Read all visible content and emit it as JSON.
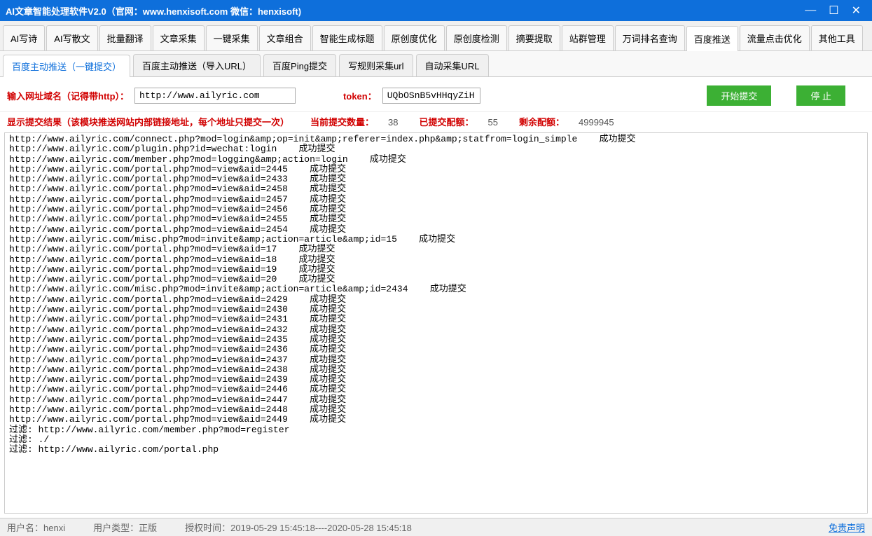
{
  "title": "AI文章智能处理软件V2.0（官网：www.henxisoft.com  微信：henxisoft)",
  "maintabs": [
    "AI写诗",
    "AI写散文",
    "批量翻译",
    "文章采集",
    "一键采集",
    "文章组合",
    "智能生成标题",
    "原创度优化",
    "原创度检测",
    "摘要提取",
    "站群管理",
    "万词排名查询",
    "百度推送",
    "流量点击优化",
    "其他工具"
  ],
  "maintab_active": 12,
  "subtabs": [
    "百度主动推送（一键提交）",
    "百度主动推送（导入URL）",
    "百度Ping提交",
    "写规则采集url",
    "自动采集URL"
  ],
  "subtab_active": 0,
  "form": {
    "url_label": "输入网址域名（记得带http）：",
    "url_value": "http://www.ailyric.com",
    "token_label": "token：",
    "token_value": "UQbOSnB5vHHqyZiH",
    "start_btn": "开始提交",
    "stop_btn": "停  止"
  },
  "result": {
    "header_label": "显示提交结果（该模块推送网站内部链接地址，每个地址只提交一次）",
    "current_label": "当前提交数量：",
    "current_val": "38",
    "submitted_label": "已提交配额：",
    "submitted_val": "55",
    "remain_label": "剩余配额：",
    "remain_val": "4999945"
  },
  "log": [
    "http://www.ailyric.com/connect.php?mod=login&amp;op=init&amp;referer=index.php&amp;statfrom=login_simple    成功提交",
    "http://www.ailyric.com/plugin.php?id=wechat:login    成功提交",
    "http://www.ailyric.com/member.php?mod=logging&amp;action=login    成功提交",
    "http://www.ailyric.com/portal.php?mod=view&aid=2445    成功提交",
    "http://www.ailyric.com/portal.php?mod=view&aid=2433    成功提交",
    "http://www.ailyric.com/portal.php?mod=view&aid=2458    成功提交",
    "http://www.ailyric.com/portal.php?mod=view&aid=2457    成功提交",
    "http://www.ailyric.com/portal.php?mod=view&aid=2456    成功提交",
    "http://www.ailyric.com/portal.php?mod=view&aid=2455    成功提交",
    "http://www.ailyric.com/portal.php?mod=view&aid=2454    成功提交",
    "http://www.ailyric.com/misc.php?mod=invite&amp;action=article&amp;id=15    成功提交",
    "http://www.ailyric.com/portal.php?mod=view&aid=17    成功提交",
    "http://www.ailyric.com/portal.php?mod=view&aid=18    成功提交",
    "http://www.ailyric.com/portal.php?mod=view&aid=19    成功提交",
    "http://www.ailyric.com/portal.php?mod=view&aid=20    成功提交",
    "http://www.ailyric.com/misc.php?mod=invite&amp;action=article&amp;id=2434    成功提交",
    "http://www.ailyric.com/portal.php?mod=view&aid=2429    成功提交",
    "http://www.ailyric.com/portal.php?mod=view&aid=2430    成功提交",
    "http://www.ailyric.com/portal.php?mod=view&aid=2431    成功提交",
    "http://www.ailyric.com/portal.php?mod=view&aid=2432    成功提交",
    "http://www.ailyric.com/portal.php?mod=view&aid=2435    成功提交",
    "http://www.ailyric.com/portal.php?mod=view&aid=2436    成功提交",
    "http://www.ailyric.com/portal.php?mod=view&aid=2437    成功提交",
    "http://www.ailyric.com/portal.php?mod=view&aid=2438    成功提交",
    "http://www.ailyric.com/portal.php?mod=view&aid=2439    成功提交",
    "http://www.ailyric.com/portal.php?mod=view&aid=2446    成功提交",
    "http://www.ailyric.com/portal.php?mod=view&aid=2447    成功提交",
    "http://www.ailyric.com/portal.php?mod=view&aid=2448    成功提交",
    "http://www.ailyric.com/portal.php?mod=view&aid=2449    成功提交",
    "",
    "过滤: http://www.ailyric.com/member.php?mod=register",
    "过滤: ./",
    "过滤: http://www.ailyric.com/portal.php"
  ],
  "status": {
    "user_label": "用户名：",
    "user_val": "henxi",
    "type_label": "用户类型：",
    "type_val": "正版",
    "auth_label": "授权时间：",
    "auth_val": "2019-05-29 15:45:18----2020-05-28 15:45:18",
    "disclaimer": "免责声明"
  }
}
